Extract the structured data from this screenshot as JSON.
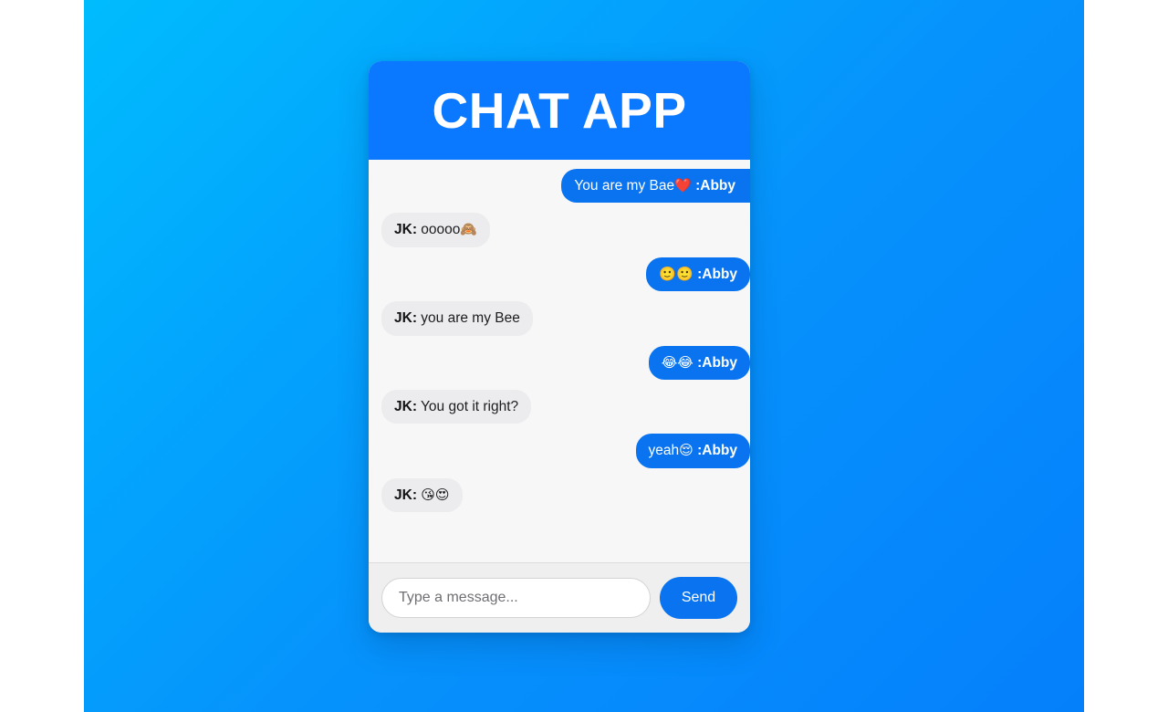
{
  "background": {
    "gradient_from": "#00bcfd",
    "gradient_to": "#0580fb"
  },
  "header": {
    "title": "CHAT APP",
    "background_color": "#0a78ff",
    "text_color": "#ffffff"
  },
  "theme": {
    "outgoing_bubble_color": "#0a74f0",
    "incoming_bubble_color": "#ececee",
    "accent_color": "#0a74f0",
    "chat_background": "#f7f7f8"
  },
  "conversation": {
    "messages": [
      {
        "side": "right",
        "sender": "Abby",
        "text": "You are my Bae",
        "emoji": "❤️",
        "emoji_name": "red-heart",
        "display": "You are my Bae❤️ :Abby"
      },
      {
        "side": "left",
        "sender": "JK",
        "text": "ooooo",
        "emoji": "🙈",
        "emoji_name": "see-no-evil-monkey",
        "display": "JK: ooooo🙈"
      },
      {
        "side": "right",
        "sender": "Abby",
        "text": "",
        "emoji": "🙂🙂",
        "emoji_name": "slightly-smiling-face",
        "display": "🙂🙂 :Abby"
      },
      {
        "side": "left",
        "sender": "JK",
        "text": "you are my Bee",
        "emoji": "",
        "emoji_name": "",
        "display": "JK: you are my Bee"
      },
      {
        "side": "right",
        "sender": "Abby",
        "text": "",
        "emoji": "😂😂",
        "emoji_name": "face-with-tears-of-joy",
        "display": "😂😂 :Abby"
      },
      {
        "side": "left",
        "sender": "JK",
        "text": "You got it right?",
        "emoji": "",
        "emoji_name": "",
        "display": "JK: You got it right?"
      },
      {
        "side": "right",
        "sender": "Abby",
        "text": "yeah",
        "emoji": "😌",
        "emoji_name": "relieved-face",
        "display": "yeah😌 :Abby"
      },
      {
        "side": "left",
        "sender": "JK",
        "text": "",
        "emoji": "😘😍",
        "emoji_name": "face-blowing-a-kiss-smiling-face-with-heart-eyes",
        "display": "JK: 😘😍"
      }
    ]
  },
  "composer": {
    "placeholder": "Type a message...",
    "value": "",
    "send_label": "Send"
  }
}
